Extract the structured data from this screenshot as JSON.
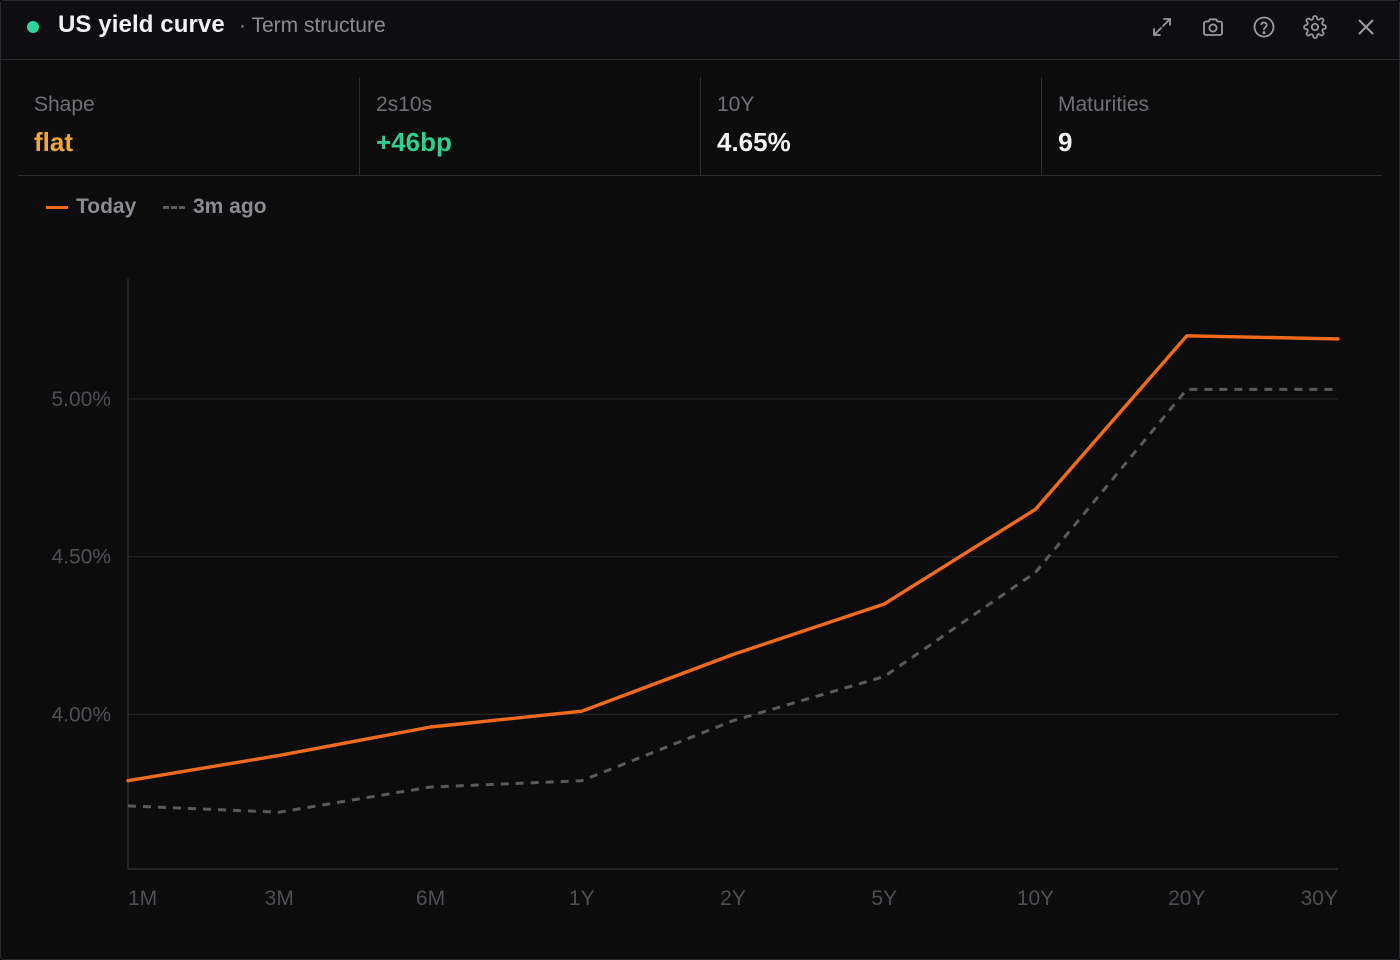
{
  "window": {
    "title": "US yield curve",
    "subtitle": "· Term structure",
    "status_color": "#2fd39a",
    "icons": [
      "expand-icon",
      "camera-icon",
      "help-icon",
      "gear-icon",
      "close-icon"
    ]
  },
  "stats": [
    {
      "label": "Shape",
      "value": "flat",
      "color": "#f5a631"
    },
    {
      "label": "2s10s",
      "value": "+46bp",
      "color": "#2fcf8f"
    },
    {
      "label": "10Y",
      "value": "4.65%",
      "color": "#f4f4f6"
    },
    {
      "label": "Maturities",
      "value": "9",
      "color": "#f4f4f6"
    }
  ],
  "legend": [
    {
      "label": "Today",
      "color": "#f26a1b",
      "style": "solid"
    },
    {
      "label": "3m ago",
      "color": "#5a5a5f",
      "style": "dashed"
    }
  ],
  "chart_data": {
    "type": "line",
    "categories": [
      "1M",
      "3M",
      "6M",
      "1Y",
      "2Y",
      "5Y",
      "10Y",
      "20Y",
      "30Y"
    ],
    "series": [
      {
        "name": "Today",
        "values": [
          3.79,
          3.87,
          3.96,
          4.01,
          4.19,
          4.35,
          4.65,
          5.2,
          5.19
        ],
        "color": "#f26a1b",
        "style": "solid"
      },
      {
        "name": "3m ago",
        "values": [
          3.71,
          3.69,
          3.77,
          3.79,
          3.98,
          4.12,
          4.45,
          5.03,
          5.03
        ],
        "color": "#5a5a5f",
        "style": "dashed"
      }
    ],
    "yticks": [
      {
        "value": 4.0,
        "label": "4.00%"
      },
      {
        "value": 4.5,
        "label": "4.50%"
      },
      {
        "value": 5.0,
        "label": "5.00%"
      }
    ],
    "ylim": [
      3.51,
      5.38
    ],
    "grid": true,
    "legend_position": "top-left"
  }
}
